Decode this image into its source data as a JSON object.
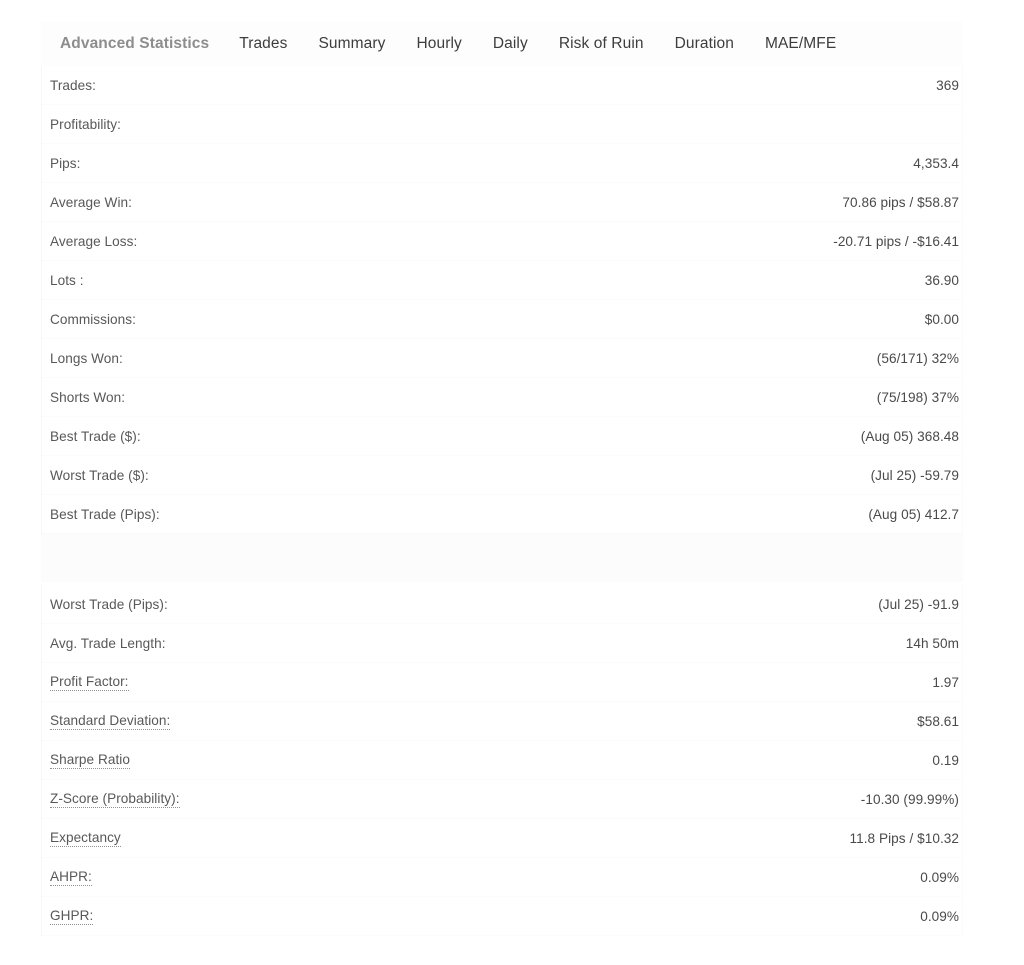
{
  "tabs": [
    {
      "label": "Advanced Statistics",
      "active": true
    },
    {
      "label": "Trades",
      "active": false
    },
    {
      "label": "Summary",
      "active": false
    },
    {
      "label": "Hourly",
      "active": false
    },
    {
      "label": "Daily",
      "active": false
    },
    {
      "label": "Risk of Ruin",
      "active": false
    },
    {
      "label": "Duration",
      "active": false
    },
    {
      "label": "MAE/MFE",
      "active": false
    }
  ],
  "stats_top": [
    {
      "label": "Trades:",
      "value": "369",
      "hinted": false
    },
    {
      "label": "Profitability:",
      "value": "",
      "hinted": false
    },
    {
      "label": "Pips:",
      "value": "4,353.4",
      "hinted": false
    },
    {
      "label": "Average Win:",
      "value": "70.86 pips / $58.87",
      "hinted": false
    },
    {
      "label": "Average Loss:",
      "value": "-20.71 pips / -$16.41",
      "hinted": false
    },
    {
      "label": "Lots :",
      "value": "36.90",
      "hinted": false
    },
    {
      "label": "Commissions:",
      "value": "$0.00",
      "hinted": false
    },
    {
      "label": "Longs Won:",
      "value": "(56/171) 32%",
      "hinted": false
    },
    {
      "label": "Shorts Won:",
      "value": "(75/198) 37%",
      "hinted": false
    },
    {
      "label": "Best Trade ($):",
      "value": "(Aug 05) 368.48",
      "hinted": false
    },
    {
      "label": "Worst Trade ($):",
      "value": "(Jul 25) -59.79",
      "hinted": false
    },
    {
      "label": "Best Trade (Pips):",
      "value": "(Aug 05) 412.7",
      "hinted": false
    }
  ],
  "stats_bottom": [
    {
      "label": "Worst Trade (Pips):",
      "value": "(Jul 25) -91.9",
      "hinted": false
    },
    {
      "label": "Avg. Trade Length:",
      "value": "14h 50m",
      "hinted": false
    },
    {
      "label": "Profit Factor:",
      "value": "1.97",
      "hinted": true
    },
    {
      "label": "Standard Deviation:",
      "value": "$58.61",
      "hinted": true
    },
    {
      "label": "Sharpe Ratio",
      "value": "0.19",
      "hinted": true
    },
    {
      "label": "Z-Score (Probability):",
      "value": "-10.30 (99.99%)",
      "hinted": true
    },
    {
      "label": "Expectancy",
      "value": "11.8 Pips / $10.32",
      "hinted": true
    },
    {
      "label": "AHPR:",
      "value": "0.09%",
      "hinted": true
    },
    {
      "label": "GHPR:",
      "value": "0.09%",
      "hinted": true
    }
  ],
  "colors": {
    "page_background": "#ffffff",
    "label_text": "#585858",
    "value_text": "#4a4a4a",
    "tab_text": "#3d3d3d",
    "tab_active_text": "#8d8d8d",
    "row_divider": "#fbfbfb"
  }
}
